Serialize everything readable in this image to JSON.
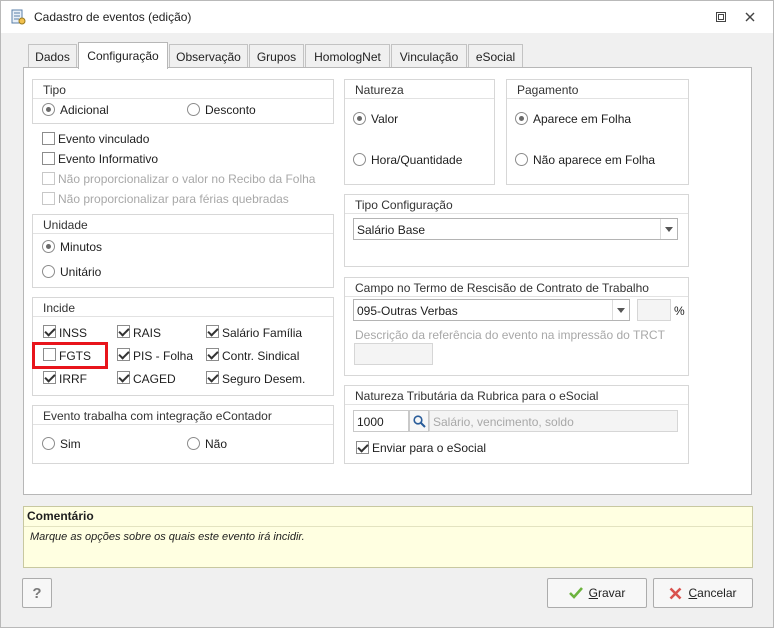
{
  "window": {
    "title": "Cadastro de eventos (edição)"
  },
  "tabs": [
    {
      "label": "Dados",
      "active": false
    },
    {
      "label": "Configuração",
      "active": true
    },
    {
      "label": "Observação",
      "active": false
    },
    {
      "label": "Grupos",
      "active": false
    },
    {
      "label": "HomologNet",
      "active": false
    },
    {
      "label": "Vinculação",
      "active": false
    },
    {
      "label": "eSocial",
      "active": false
    }
  ],
  "tipo": {
    "title": "Tipo",
    "options": [
      {
        "label": "Adicional",
        "selected": true
      },
      {
        "label": "Desconto",
        "selected": false
      }
    ]
  },
  "flags": [
    {
      "label": "Evento vinculado",
      "checked": false,
      "enabled": true
    },
    {
      "label": "Evento Informativo",
      "checked": false,
      "enabled": true
    },
    {
      "label": "Não proporcionalizar o valor no Recibo da Folha",
      "checked": false,
      "enabled": false
    },
    {
      "label": "Não proporcionalizar para férias quebradas",
      "checked": false,
      "enabled": false
    }
  ],
  "unidade": {
    "title": "Unidade",
    "options": [
      {
        "label": "Minutos",
        "selected": true
      },
      {
        "label": "Unitário",
        "selected": false
      }
    ]
  },
  "incide": {
    "title": "Incide",
    "items": [
      {
        "label": "INSS",
        "checked": true
      },
      {
        "label": "RAIS",
        "checked": true
      },
      {
        "label": "Salário Família",
        "checked": true
      },
      {
        "label": "FGTS",
        "checked": false
      },
      {
        "label": "PIS - Folha",
        "checked": true
      },
      {
        "label": "Contr. Sindical",
        "checked": true
      },
      {
        "label": "IRRF",
        "checked": true
      },
      {
        "label": "CAGED",
        "checked": true
      },
      {
        "label": "Seguro Desem.",
        "checked": true
      }
    ]
  },
  "econtador": {
    "title": "Evento trabalha com integração eContador",
    "options": [
      {
        "label": "Sim",
        "selected": false
      },
      {
        "label": "Não",
        "selected": false
      }
    ]
  },
  "natureza": {
    "title": "Natureza",
    "options": [
      {
        "label": "Valor",
        "selected": true
      },
      {
        "label": "Hora/Quantidade",
        "selected": false
      }
    ]
  },
  "pagamento": {
    "title": "Pagamento",
    "options": [
      {
        "label": "Aparece em Folha",
        "selected": true
      },
      {
        "label": "Não aparece em Folha",
        "selected": false
      }
    ]
  },
  "tipo_config": {
    "title": "Tipo Configuração",
    "value": "Salário Base"
  },
  "rescisao": {
    "title": "Campo no Termo de Rescisão de Contrato de Trabalho",
    "value": "095-Outras Verbas",
    "percent_value": "",
    "percent_symbol": "%",
    "desc_label": "Descrição da referência do evento na impressão do TRCT",
    "desc_value": ""
  },
  "natureza_trib": {
    "title": "Natureza Tributária da Rubrica para o eSocial",
    "code": "1000",
    "description_placeholder": "Salário, vencimento, soldo",
    "send_label": "Enviar para o eSocial",
    "send_checked": true
  },
  "comment": {
    "title": "Comentário",
    "text": "Marque as opções sobre os quais este evento irá incidir."
  },
  "buttons": {
    "help": "?",
    "save_first": "G",
    "save_rest": "ravar",
    "cancel_first": "C",
    "cancel_rest": "ancelar"
  },
  "colors": {
    "highlight": "#e8141b",
    "comment_bg": "#ffffe1",
    "save_icon": "#6cb33e",
    "cancel_icon": "#d9534f"
  }
}
